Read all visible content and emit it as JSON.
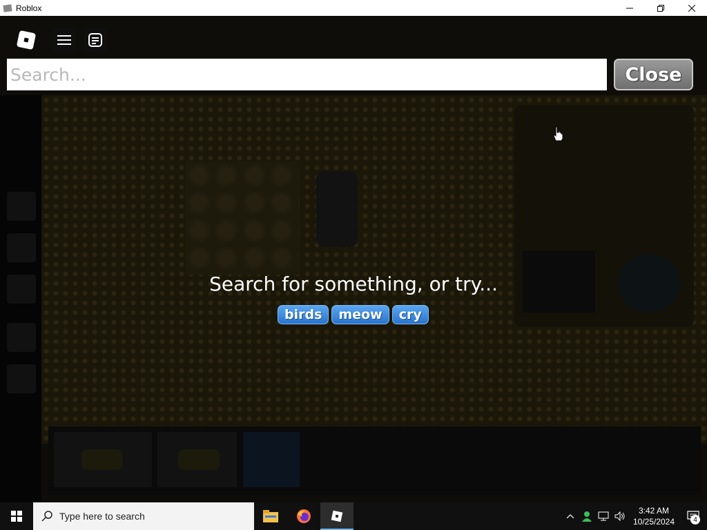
{
  "window": {
    "title": "Roblox",
    "controls": [
      "minimize-icon",
      "restore-icon",
      "close-icon"
    ]
  },
  "search": {
    "placeholder": "Search...",
    "value": "",
    "close_label": "Close"
  },
  "prompt": "Search for something, or try...",
  "suggestions": [
    "birds",
    "meow",
    "cry"
  ],
  "topbar": {
    "icons": [
      "roblox-logo",
      "menu-icon",
      "chat-icon"
    ]
  },
  "taskbar": {
    "search_placeholder": "Type here to search",
    "apps": [
      "file-explorer-icon",
      "firefox-icon",
      "roblox-icon"
    ],
    "time": "3:42 AM",
    "date": "10/25/2024",
    "notification_count": "4"
  },
  "colors": {
    "chip_blue": "#3a8ae0",
    "close_gray": "#858585",
    "taskbar": "#101010"
  }
}
